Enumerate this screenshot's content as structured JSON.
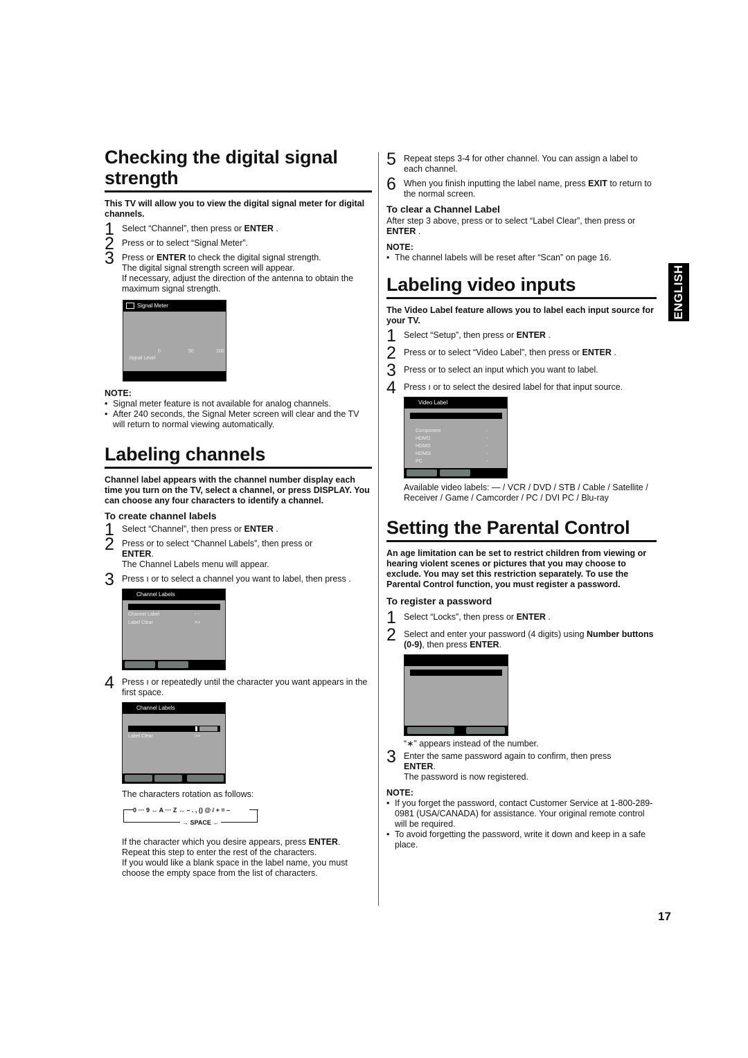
{
  "page_number": "17",
  "language_tab": "ENGLISH",
  "signal": {
    "title": "Checking the digital signal strength",
    "intro": "This TV will allow you to view the digital signal meter for digital channels.",
    "steps": [
      {
        "num": "1",
        "pre": "Select “Channel”, then press    or ",
        "bold": "ENTER",
        "post": " ."
      },
      {
        "num": "2",
        "pre": "Press    or    to select “Signal Meter”.",
        "bold": "",
        "post": ""
      },
      {
        "num": "3",
        "pre": "Press     or ",
        "bold": "ENTER",
        "post": " to check the digital signal strength."
      }
    ],
    "step3_extra": [
      "The digital signal strength screen will appear.",
      "If necessary, adjust the direction of the antenna to obtain the maximum signal strength."
    ],
    "osd": {
      "title": "Signal Meter",
      "scale": [
        "0",
        "50",
        "100"
      ],
      "label": "Signal Level"
    },
    "note_head": "NOTE:",
    "notes": [
      "Signal meter feature is not available for analog channels.",
      "After 240 seconds, the Signal Meter screen will clear and the TV will return to normal viewing automatically."
    ]
  },
  "channels": {
    "title": "Labeling channels",
    "intro": "Channel label appears with the channel number display each time you turn on the TV, select a channel, or press DISPLAY. You can choose any four characters to identify a channel.",
    "subhead": "To create channel labels",
    "step1": {
      "num": "1",
      "pre": "Select “Channel”, then press    or ",
      "bold": "ENTER",
      "post": " ."
    },
    "step2": {
      "num": "2",
      "pre": "Press    or    to select “Channel Labels”, then press      or ",
      "bold": "ENTER",
      "post": ".",
      "extra": "The Channel Labels menu will appear."
    },
    "step3": {
      "num": "3",
      "text": "Press  ı  or     to select a channel you want to label, then press    ."
    },
    "osd1": {
      "title": "Channel Labels",
      "rows": [
        {
          "label": "Channel Label",
          "value": "- -"
        },
        {
          "label": "Label Clear",
          "value": ">>"
        }
      ]
    },
    "step4": {
      "num": "4",
      "text": "Press  ı  or     repeatedly until the character you want appears in the first space."
    },
    "osd2": {
      "title": "Channel Labels",
      "rows": [
        {
          "label": "Label Clear",
          "value": ">>"
        }
      ]
    },
    "rotation_intro": "The characters rotation as follows:",
    "rotation_line": "0 ··· 9 ↔ A ··· Z ↔ – . , () @ / + = –",
    "rotation_space": "→ SPACE ←",
    "outro_pre": "If the character which you desire appears, press ",
    "outro_bold": "ENTER",
    "outro_post": ".",
    "outro_lines": [
      "Repeat this step to enter the rest of the characters.",
      "If you would like a blank space in the label name, you must choose the empty space from the list of characters."
    ]
  },
  "right_top": {
    "step5": {
      "num": "5",
      "text": "Repeat steps 3-4 for other channel. You can assign a label to each channel."
    },
    "step6": {
      "num": "6",
      "pre": "When you finish inputting the label name, press ",
      "bold": "EXIT",
      "post": " to return to the normal screen."
    },
    "clear_head": "To clear a Channel Label",
    "clear_pre": "After step 3 above, press    or    to select “Label Clear”, then press    or ",
    "clear_bold": "ENTER",
    "clear_post": " .",
    "note_head": "NOTE:",
    "notes": [
      "The channel labels will be reset after “Scan” on page 16."
    ]
  },
  "video": {
    "title": "Labeling video inputs",
    "intro": "The Video Label feature allows you to label each input source for your TV.",
    "steps": [
      {
        "num": "1",
        "pre": "Select “Setup”, then press    or ",
        "bold": "ENTER",
        "post": " ."
      },
      {
        "num": "2",
        "pre": "Press    or    to select “Video Label”, then press      or ",
        "bold": "ENTER",
        "post": " ."
      },
      {
        "num": "3",
        "pre": "Press    or    to select an input which you want to label.",
        "bold": "",
        "post": ""
      },
      {
        "num": "4",
        "pre": "Press  ı  or    to select the desired label for that input source.",
        "bold": "",
        "post": ""
      }
    ],
    "osd": {
      "title": "Video Label",
      "rows": [
        {
          "label": "Component",
          "value": "-"
        },
        {
          "label": "HDMI1",
          "value": "-"
        },
        {
          "label": "HDMI2",
          "value": "-"
        },
        {
          "label": "HDMI3",
          "value": "-"
        },
        {
          "label": "PC",
          "value": "-"
        }
      ]
    },
    "available": "Available video labels: — / VCR / DVD / STB / Cable / Satellite / Receiver / Game / Camcorder / PC / DVI PC / Blu-ray"
  },
  "parental": {
    "title": "Setting the Parental Control",
    "intro": "An age limitation can be set to restrict children from viewing or hearing violent scenes or pictures that you may choose to exclude. You may set this restriction separately. To use the Parental Control function, you must register a password.",
    "subhead": "To register a password",
    "step1": {
      "num": "1",
      "pre": "Select “Locks”, then press    or ",
      "bold": "ENTER",
      "post": " ."
    },
    "step2": {
      "num": "2",
      "pre": "Select and enter your password (4 digits) using ",
      "bold": "Number buttons (0-9)",
      "mid": ", then press ",
      "bold2": "ENTER",
      "post": "."
    },
    "asterisk_note": "“∗” appears instead of the number.",
    "step3": {
      "num": "3",
      "pre": "Enter the same password again to confirm, then press ",
      "bold": "ENTER",
      "post": ".",
      "extra": "The password is now registered."
    },
    "note_head": "NOTE:",
    "notes": [
      "If you forget the password, contact Customer Service at 1-800-289-0981 (USA/CANADA) for assistance. Your original remote control will be required.",
      "To avoid forgetting the password, write it down and keep in a safe place."
    ]
  }
}
